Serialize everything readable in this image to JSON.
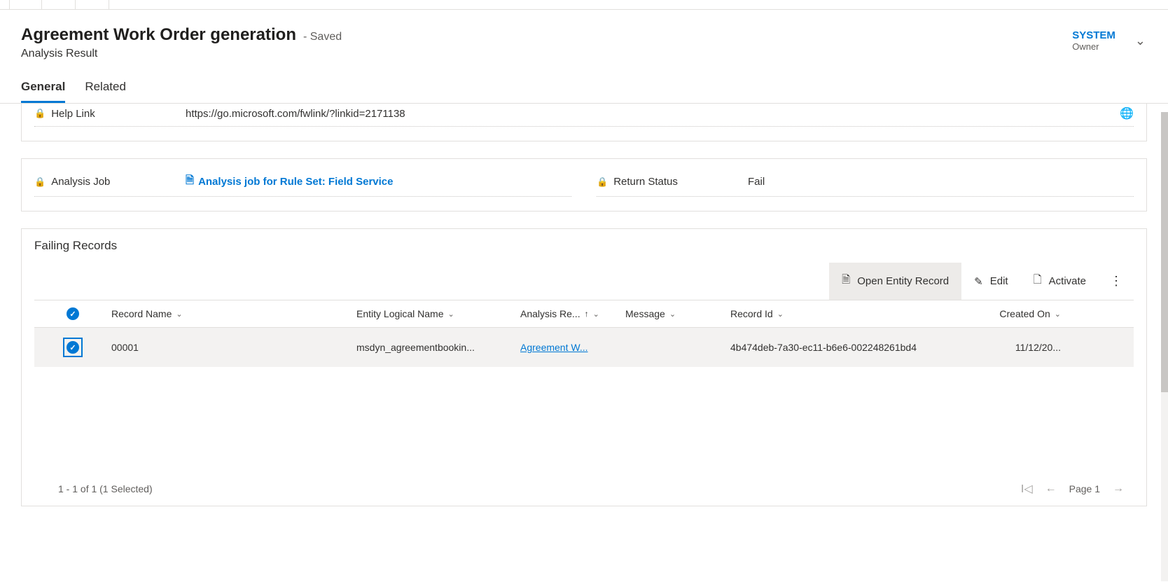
{
  "header": {
    "title": "Agreement Work Order generation",
    "save_state": "- Saved",
    "entity_type": "Analysis Result",
    "owner_value": "SYSTEM",
    "owner_label": "Owner"
  },
  "tabs": {
    "general": "General",
    "related": "Related"
  },
  "fields": {
    "help_link": {
      "label": "Help Link",
      "value": "https://go.microsoft.com/fwlink/?linkid=2171138"
    },
    "analysis_job": {
      "label": "Analysis Job",
      "value": "Analysis job for Rule Set: Field Service"
    },
    "return_status": {
      "label": "Return Status",
      "value": "Fail"
    }
  },
  "grid": {
    "title": "Failing Records",
    "commands": {
      "open": "Open Entity Record",
      "edit": "Edit",
      "activate": "Activate"
    },
    "columns": {
      "record_name": "Record Name",
      "entity_logical": "Entity Logical Name",
      "analysis_re": "Analysis Re...",
      "message": "Message",
      "record_id": "Record Id",
      "created_on": "Created On"
    },
    "rows": [
      {
        "record_name": "00001",
        "entity_logical": "msdyn_agreementbookin...",
        "analysis_re": "Agreement W...",
        "message": "",
        "record_id": "4b474deb-7a30-ec11-b6e6-002248261bd4",
        "created_on": "11/12/20..."
      }
    ],
    "footer_count": "1 - 1 of 1 (1 Selected)",
    "page_label": "Page 1"
  }
}
